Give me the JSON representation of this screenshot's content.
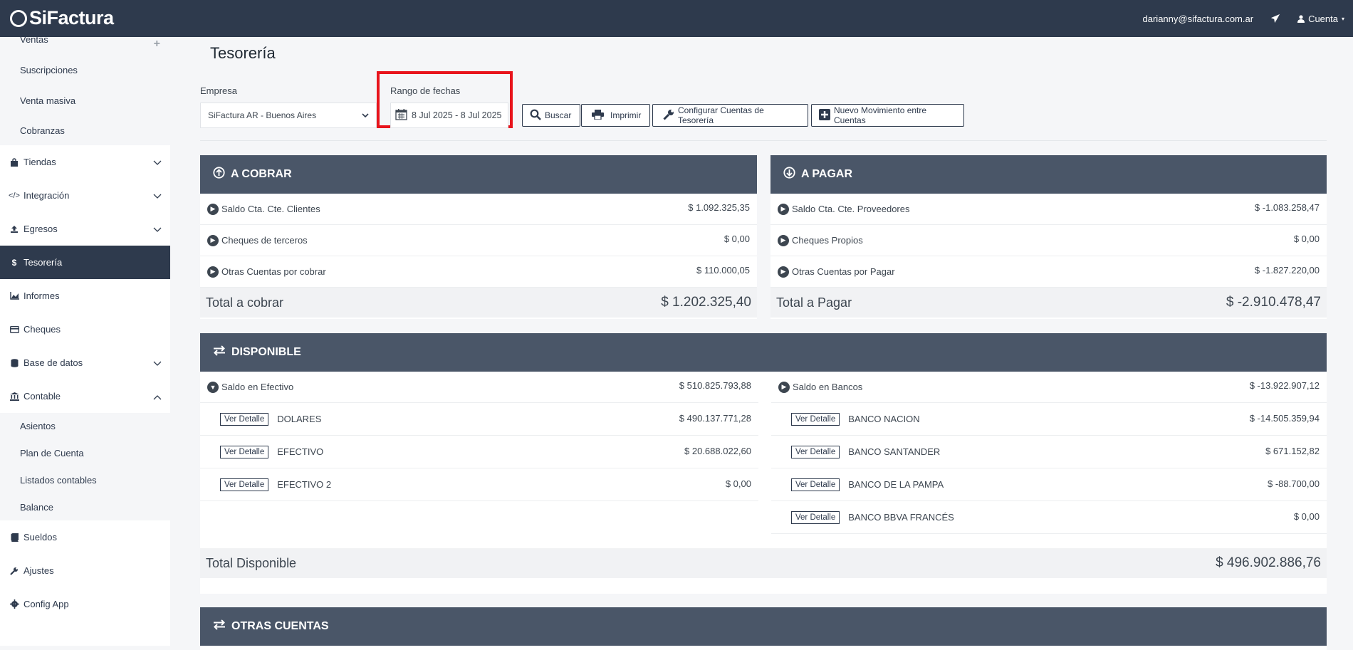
{
  "app": {
    "logo": "SiFactura",
    "user_email": "darianny@sifactura.com.ar",
    "account_label": "Cuenta"
  },
  "sidebar": {
    "ventas": "Ventas",
    "suscripciones": "Suscripciones",
    "venta_masiva": "Venta masiva",
    "cobranzas": "Cobranzas",
    "tiendas": "Tiendas",
    "integracion": "Integración",
    "egresos": "Egresos",
    "tesoreria": "Tesorería",
    "informes": "Informes",
    "cheques": "Cheques",
    "base_datos": "Base de datos",
    "contable": "Contable",
    "asientos": "Asientos",
    "plan_cuenta": "Plan de Cuenta",
    "listados": "Listados contables",
    "balance": "Balance",
    "sueldos": "Sueldos",
    "ajustes": "Ajustes",
    "config_app": "Config App"
  },
  "page": {
    "title": "Tesorería"
  },
  "filters": {
    "empresa_label": "Empresa",
    "empresa_value": "SiFactura AR - Buenos Aires",
    "rango_label": "Rango de fechas",
    "rango_value": "8 Jul 2025 - 8 Jul 2025"
  },
  "buttons": {
    "buscar": "Buscar",
    "imprimir": "Imprimir",
    "configurar": "Configurar Cuentas de Tesorería",
    "nuevo": "Nuevo Movimiento entre Cuentas"
  },
  "a_cobrar": {
    "title": "A COBRAR",
    "rows": [
      {
        "label": "Saldo Cta. Cte. Clientes",
        "amount": "$ 1.092.325,35"
      },
      {
        "label": "Cheques de terceros",
        "amount": "$ 0,00"
      },
      {
        "label": "Otras Cuentas por cobrar",
        "amount": "$ 110.000,05"
      }
    ],
    "total_label": "Total a cobrar",
    "total": "$ 1.202.325,40"
  },
  "a_pagar": {
    "title": "A PAGAR",
    "rows": [
      {
        "label": "Saldo Cta. Cte. Proveedores",
        "amount": "$ -1.083.258,47"
      },
      {
        "label": "Cheques Propios",
        "amount": "$ 0,00"
      },
      {
        "label": "Otras Cuentas por Pagar",
        "amount": "$ -1.827.220,00"
      }
    ],
    "total_label": "Total a Pagar",
    "total": "$ -2.910.478,47"
  },
  "disponible": {
    "title": "DISPONIBLE",
    "ver_detalle": "Ver Detalle",
    "efectivo": {
      "label": "Saldo en Efectivo",
      "amount": "$ 510.825.793,88",
      "items": [
        {
          "name": "DOLARES",
          "amount": "$ 490.137.771,28"
        },
        {
          "name": "EFECTIVO",
          "amount": "$ 20.688.022,60"
        },
        {
          "name": "EFECTIVO 2",
          "amount": "$ 0,00"
        }
      ]
    },
    "bancos": {
      "label": "Saldo en Bancos",
      "amount": "$ -13.922.907,12",
      "items": [
        {
          "name": "BANCO NACION",
          "amount": "$ -14.505.359,94"
        },
        {
          "name": "BANCO SANTANDER",
          "amount": "$ 671.152,82"
        },
        {
          "name": "BANCO DE LA PAMPA",
          "amount": "$ -88.700,00"
        },
        {
          "name": "BANCO BBVA FRANCÉS",
          "amount": "$ 0,00"
        }
      ]
    },
    "total_label": "Total Disponible",
    "total": "$ 496.902.886,76"
  },
  "otras_cuentas": {
    "title": "OTRAS CUENTAS"
  },
  "colors": {
    "topbar": "#2e3a4d",
    "card_header": "#4a5668",
    "highlight": "#e8141c"
  },
  "icons": [
    "calendar-icon",
    "search-icon",
    "print-icon",
    "wrench-icon",
    "plus-square-icon",
    "send-icon",
    "user-icon"
  ]
}
